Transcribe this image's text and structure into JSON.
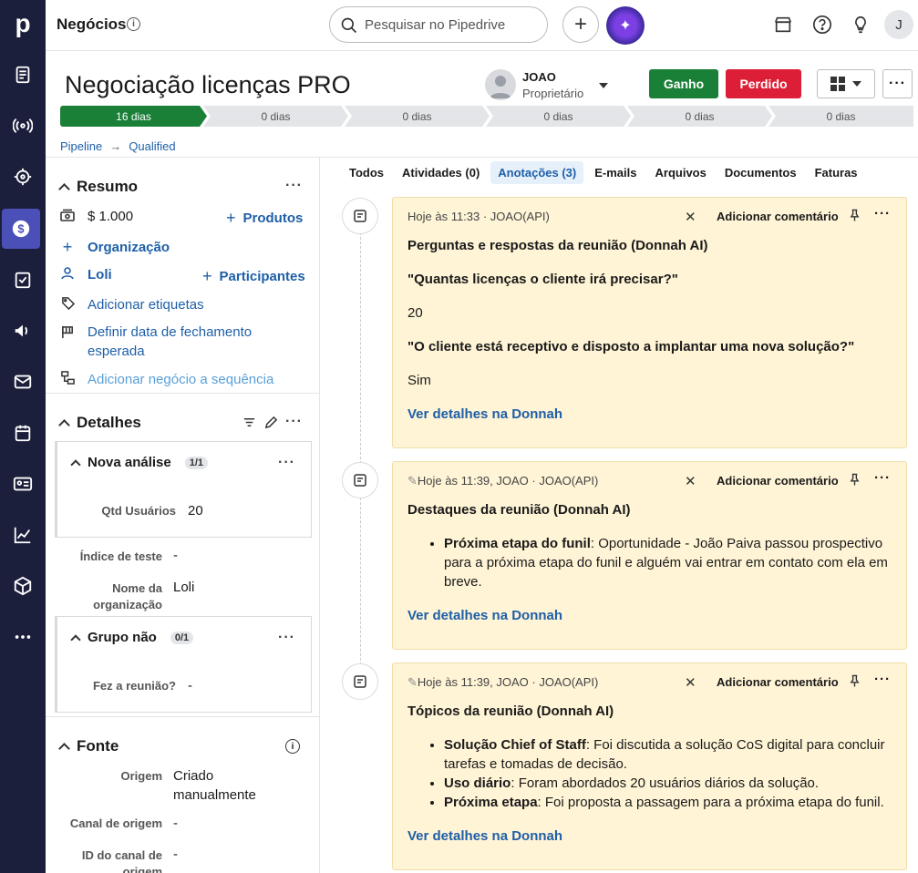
{
  "nav": {
    "logo": "p",
    "items": [
      "notes-icon",
      "radio-icon",
      "target-icon",
      "deals-icon",
      "tasks-icon",
      "campaigns-icon",
      "mail-icon",
      "calendar-icon",
      "contacts-icon",
      "insights-icon",
      "products-icon",
      "more-icon"
    ],
    "active": "deals-icon"
  },
  "topbar": {
    "title": "Negócios",
    "search_placeholder": "Pesquisar no Pipedrive",
    "user_initial": "J"
  },
  "deal": {
    "title": "Negociação licenças PRO",
    "owner_name": "JOAO",
    "owner_role": "Proprietário",
    "won_label": "Ganho",
    "lost_label": "Perdido",
    "more_label": "···"
  },
  "stages": [
    {
      "label": "16 dias",
      "done": true
    },
    {
      "label": "0 dias",
      "done": false
    },
    {
      "label": "0 dias",
      "done": false
    },
    {
      "label": "0 dias",
      "done": false
    },
    {
      "label": "0 dias",
      "done": false
    },
    {
      "label": "0 dias",
      "done": false
    }
  ],
  "breadcrumb": {
    "pipeline": "Pipeline",
    "stage": "Qualified"
  },
  "summary": {
    "title": "Resumo",
    "value": "$ 1.000",
    "products": "Produtos",
    "organization": "Organização",
    "person": "Loli",
    "participants": "Participantes",
    "tags": "Adicionar etiquetas",
    "close_date_line1": "Definir data de fechamento",
    "close_date_line2": "esperada",
    "sequence": "Adicionar negócio a sequência"
  },
  "details": {
    "title": "Detalhes",
    "group1": {
      "title": "Nova análise",
      "badge": "1/1",
      "label": "Qtd Usuários",
      "value": "20"
    },
    "test_index_label": "Índice de teste",
    "test_index_value": "-",
    "org_name_label_1": "Nome da",
    "org_name_label_2": "organização",
    "org_name_value": "Loli",
    "group2": {
      "title": "Grupo não",
      "badge": "0/1",
      "label": "Fez a reunião?",
      "value": "-"
    }
  },
  "source": {
    "title": "Fonte",
    "origin_label": "Origem",
    "origin_value_1": "Criado",
    "origin_value_2": "manualmente",
    "channel_label": "Canal de origem",
    "channel_value": "-",
    "channel_id_label_1": "ID do canal de",
    "channel_id_label_2": "origem",
    "channel_id_value": "-"
  },
  "tabs": [
    {
      "label": "Todos",
      "active": false
    },
    {
      "label": "Atividades (0)",
      "active": false
    },
    {
      "label": "Anotações (3)",
      "active": true
    },
    {
      "label": "E-mails",
      "active": false
    },
    {
      "label": "Arquivos",
      "active": false
    },
    {
      "label": "Documentos",
      "active": false
    },
    {
      "label": "Faturas",
      "active": false
    }
  ],
  "notes": [
    {
      "meta": "Hoje às 11:33 · JOAO(API)",
      "add_comment": "Adicionar comentário",
      "heading": "Perguntas e respostas da reunião (Donnah AI)",
      "q1": "\"Quantas licenças o cliente irá precisar?\"",
      "a1": "20",
      "q2": "\"O cliente está receptivo e disposto a implantar uma nova solução?\"",
      "a2": "Sim",
      "link": "Ver detalhes na Donnah"
    },
    {
      "meta": "Hoje às 11:39, JOAO · JOAO(API)",
      "add_comment": "Adicionar comentário",
      "heading": "Destaques da reunião (Donnah AI)",
      "b1_bold": "Próxima etapa do funil",
      "b1_text": ": Oportunidade - João Paiva passou prospectivo para a próxima etapa do funil e alguém vai entrar em contato com ela em breve.",
      "link": "Ver detalhes na Donnah"
    },
    {
      "meta": "Hoje às 11:39, JOAO · JOAO(API)",
      "add_comment": "Adicionar comentário",
      "heading": "Tópicos da reunião (Donnah AI)",
      "b1_bold": "Solução Chief of Staff",
      "b1_text": ": Foi discutida a solução CoS digital para concluir tarefas e tomadas de decisão.",
      "b2_bold": "Uso diário",
      "b2_text": ": Foram abordados 20 usuários diários da solução.",
      "b3_bold": "Próxima etapa",
      "b3_text": ": Foi proposta a passagem para a próxima etapa do funil.",
      "link": "Ver detalhes na Donnah"
    }
  ]
}
